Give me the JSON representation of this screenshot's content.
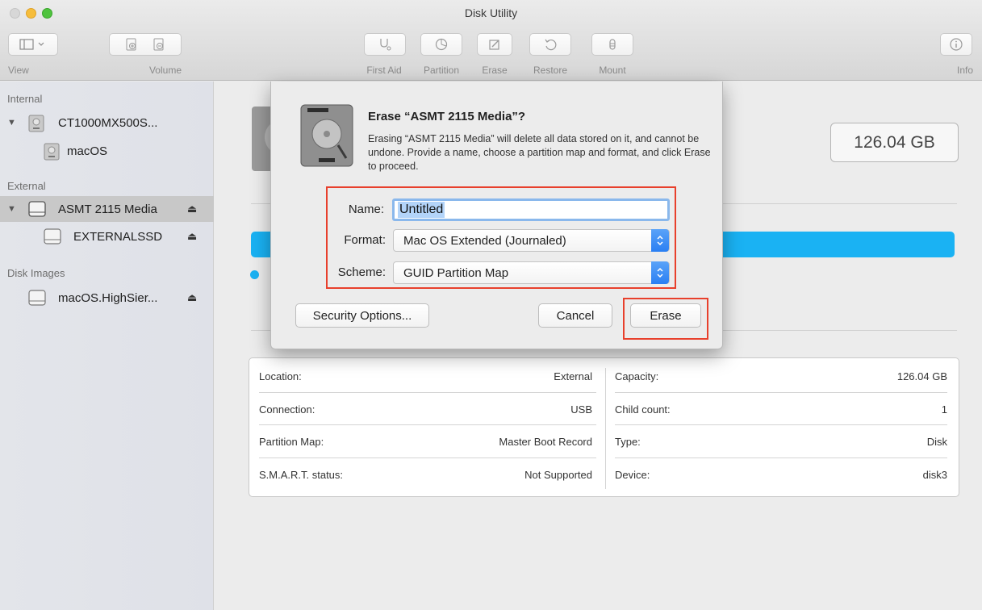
{
  "window": {
    "title": "Disk Utility"
  },
  "toolbar": {
    "view_label": "View",
    "volume_label": "Volume",
    "first_aid_label": "First Aid",
    "partition_label": "Partition",
    "erase_label": "Erase",
    "restore_label": "Restore",
    "mount_label": "Mount",
    "info_label": "Info"
  },
  "sidebar": {
    "sections": [
      {
        "title": "Internal"
      },
      {
        "title": "External"
      },
      {
        "title": "Disk Images"
      }
    ],
    "items": [
      {
        "label": "CT1000MX500S...",
        "level": 0,
        "eject": ""
      },
      {
        "label": "macOS",
        "level": 1,
        "eject": ""
      },
      {
        "label": "ASMT 2115 Media",
        "level": 0,
        "eject": "⏏",
        "selected": true
      },
      {
        "label": "EXTERNALSSD",
        "level": 1,
        "eject": "⏏"
      },
      {
        "label": "macOS.HighSier...",
        "level": 0,
        "eject": "⏏"
      }
    ]
  },
  "main": {
    "capacity_badge": "126.04 GB",
    "usage_fill_fraction": 1.0,
    "accent_color": "#1ab2f3",
    "info_rows": [
      {
        "left_label": "Location:",
        "left_value": "External",
        "right_label": "Capacity:",
        "right_value": "126.04 GB"
      },
      {
        "left_label": "Connection:",
        "left_value": "USB",
        "right_label": "Child count:",
        "right_value": "1"
      },
      {
        "left_label": "Partition Map:",
        "left_value": "Master Boot Record",
        "right_label": "Type:",
        "right_value": "Disk"
      },
      {
        "left_label": "S.M.A.R.T. status:",
        "left_value": "Not Supported",
        "right_label": "Device:",
        "right_value": "disk3"
      }
    ]
  },
  "erase_sheet": {
    "title": "Erase “ASMT 2115 Media”?",
    "message": "Erasing “ASMT 2115 Media” will delete all data stored on it, and cannot be undone. Provide a name, choose a partition map and format, and click Erase to proceed.",
    "name_label": "Name:",
    "name_value": "Untitled",
    "format_label": "Format:",
    "format_value": "Mac OS Extended (Journaled)",
    "scheme_label": "Scheme:",
    "scheme_value": "GUID Partition Map",
    "security_button": "Security Options...",
    "cancel_button": "Cancel",
    "erase_button": "Erase",
    "highlight_color": "#e8402c"
  }
}
